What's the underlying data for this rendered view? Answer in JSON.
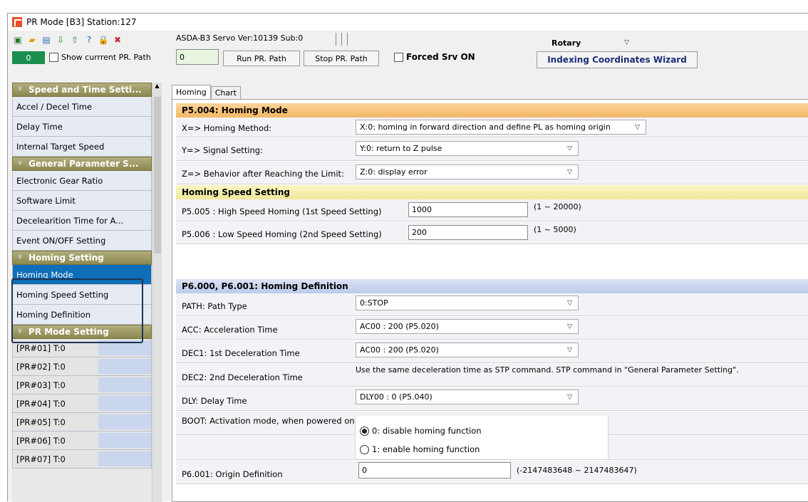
{
  "window": {
    "title": "PR Mode [B3] Station:127"
  },
  "toolbar": {
    "icons": [
      "save-icon",
      "open-folder-icon",
      "document-icon",
      "download-icon",
      "upload-icon",
      "help-icon",
      "lock-icon",
      "close-x-icon"
    ],
    "version": "ASDA-B3 Servo Ver:10139 Sub:0",
    "mode_select": "Rotary",
    "pr_badge": "0",
    "show_path_label": "Show currrent PR. Path",
    "path_value": "0",
    "run_label": "Run PR. Path",
    "stop_label": "Stop PR. Path",
    "forced_label": "Forced Srv ON",
    "wizard_label": "Indexing Coordinates Wizard"
  },
  "sidebar": {
    "groups": [
      {
        "header": "Speed and Time Setti...",
        "items": [
          "Accel / Decel Time",
          "Delay Time",
          "Internal Target Speed"
        ]
      },
      {
        "header": "General Parameter S...",
        "items": [
          "Electronic Gear Ratio",
          "Software Limit",
          "Decelearition Time for A...",
          "Event ON/OFF Setting"
        ]
      },
      {
        "header": "Homing Setting",
        "items": [
          "Homing Mode",
          "Homing Speed Setting",
          "Homing Definition"
        ]
      },
      {
        "header": "PR Mode Setting",
        "items": [
          "[PR#01]  T:0",
          "[PR#02]  T:0",
          "[PR#03]  T:0",
          "[PR#04]  T:0",
          "[PR#05]  T:0",
          "[PR#06]  T:0",
          "[PR#07]  T:0"
        ]
      }
    ]
  },
  "tabs": [
    "Homing",
    "Chart"
  ],
  "homing_mode": {
    "header": "P5.004: Homing Mode",
    "x_label": "X=> Homing Method:",
    "x_value": "X:0: homing in forward direction and define PL as homing origin",
    "y_label": "Y=> Signal Setting:",
    "y_value": "Y:0: return to Z pulse",
    "z_label": "Z=> Behavior after Reaching the Limit:",
    "z_value": "Z:0: display error"
  },
  "speed": {
    "header": "Homing Speed Setting",
    "high_label": "P5.005 : High Speed Homing (1st Speed Setting)",
    "high_value": "1000",
    "high_range": "(1 ~ 20000)",
    "low_label": "P5.006 : Low Speed Homing (2nd Speed Setting)",
    "low_value": "200",
    "low_range": "(1 ~ 5000)"
  },
  "definition": {
    "header": "P6.000, P6.001: Homing Definition",
    "path_label": "PATH: Path Type",
    "path_value": "0:STOP",
    "acc_label": "ACC: Acceleration Time",
    "acc_value": "AC00 : 200 (P5.020)",
    "dec1_label": "DEC1: 1st Deceleration Time",
    "dec1_value": "AC00 : 200 (P5.020)",
    "dec2_label": "DEC2: 2nd Deceleration Time",
    "dec2_note": "Use the same deceleration time as STP command. STP command in \"General Parameter Setting\".",
    "dly_label": "DLY: Delay Time",
    "dly_value": "DLY00 : 0 (P5.040)",
    "boot_label": "BOOT: Activation mode, when powered on:",
    "boot_opt0": "0: disable homing function",
    "boot_opt1": "1: enable homing function",
    "origin_label": "P6.001: Origin Definition",
    "origin_value": "0",
    "origin_range": "(-2147483648 ~ 2147483647)"
  },
  "colors": {
    "section_orange": "#f6c27a",
    "section_yellow": "#f4eeae",
    "section_blue": "#c7d4ef",
    "sidebar_header": "#8f8a4f",
    "selected": "#0e6eb8"
  }
}
